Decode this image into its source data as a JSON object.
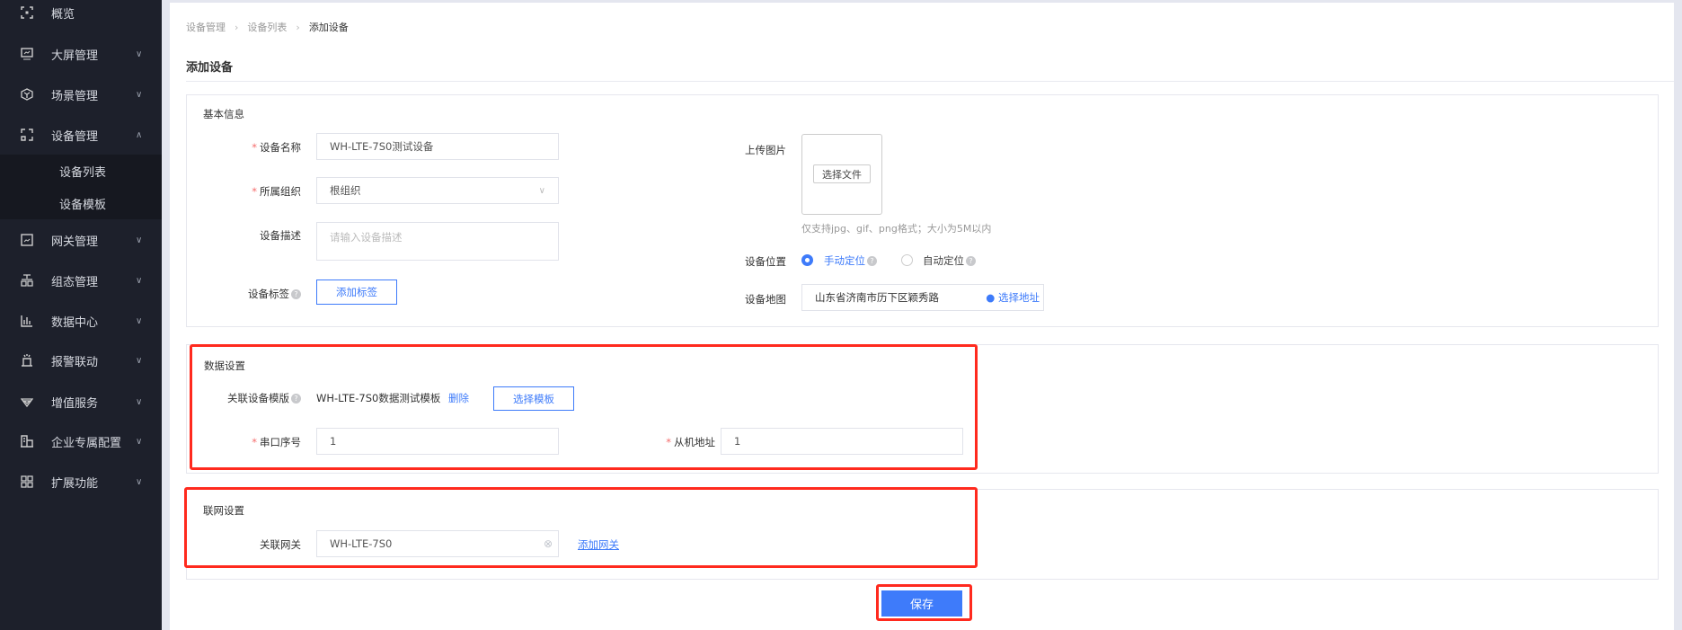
{
  "sidebar": {
    "items": [
      {
        "label": "概览",
        "icon": "overview-icon"
      },
      {
        "label": "大屏管理",
        "icon": "screen-icon"
      },
      {
        "label": "场景管理",
        "icon": "scene-icon"
      },
      {
        "label": "设备管理",
        "icon": "device-icon",
        "expanded": true,
        "children": [
          {
            "label": "设备列表"
          },
          {
            "label": "设备模板"
          }
        ]
      },
      {
        "label": "网关管理",
        "icon": "gateway-icon"
      },
      {
        "label": "组态管理",
        "icon": "config-icon"
      },
      {
        "label": "数据中心",
        "icon": "chart-icon"
      },
      {
        "label": "报警联动",
        "icon": "alarm-icon"
      },
      {
        "label": "增值服务",
        "icon": "diamond-icon"
      },
      {
        "label": "企业专属配置",
        "icon": "enterprise-icon"
      },
      {
        "label": "扩展功能",
        "icon": "grid-icon"
      }
    ]
  },
  "breadcrumb": [
    "设备管理",
    "设备列表",
    "添加设备"
  ],
  "page_title": "添加设备",
  "basic": {
    "title": "基本信息",
    "name_label": "设备名称",
    "name_value": "WH-LTE-7S0测试设备",
    "org_label": "所属组织",
    "org_value": "根组织",
    "desc_label": "设备描述",
    "desc_placeholder": "请输入设备描述",
    "tag_label": "设备标签",
    "tag_button": "添加标签",
    "upload_label": "上传图片",
    "upload_button": "选择文件",
    "upload_hint": "仅支持jpg、gif、png格式；大小为5M以内",
    "location_label": "设备位置",
    "location_manual": "手动定位",
    "location_auto": "自动定位",
    "map_label": "设备地图",
    "map_value": "山东省济南市历下区颖秀路",
    "map_button": "选择地址"
  },
  "data_settings": {
    "title": "数据设置",
    "template_label": "关联设备模版",
    "template_value": "WH-LTE-7S0数据测试模板",
    "delete_label": "删除",
    "select_template": "选择模板",
    "serial_label": "串口序号",
    "serial_value": "1",
    "slave_label": "从机地址",
    "slave_value": "1"
  },
  "network": {
    "title": "联网设置",
    "gateway_label": "关联网关",
    "gateway_value": "WH-LTE-7S0",
    "add_gateway": "添加网关"
  },
  "save_label": "保存",
  "colors": {
    "primary": "#3e7bfa",
    "highlight": "#ff2a1e",
    "sidebar": "#1d202b"
  }
}
